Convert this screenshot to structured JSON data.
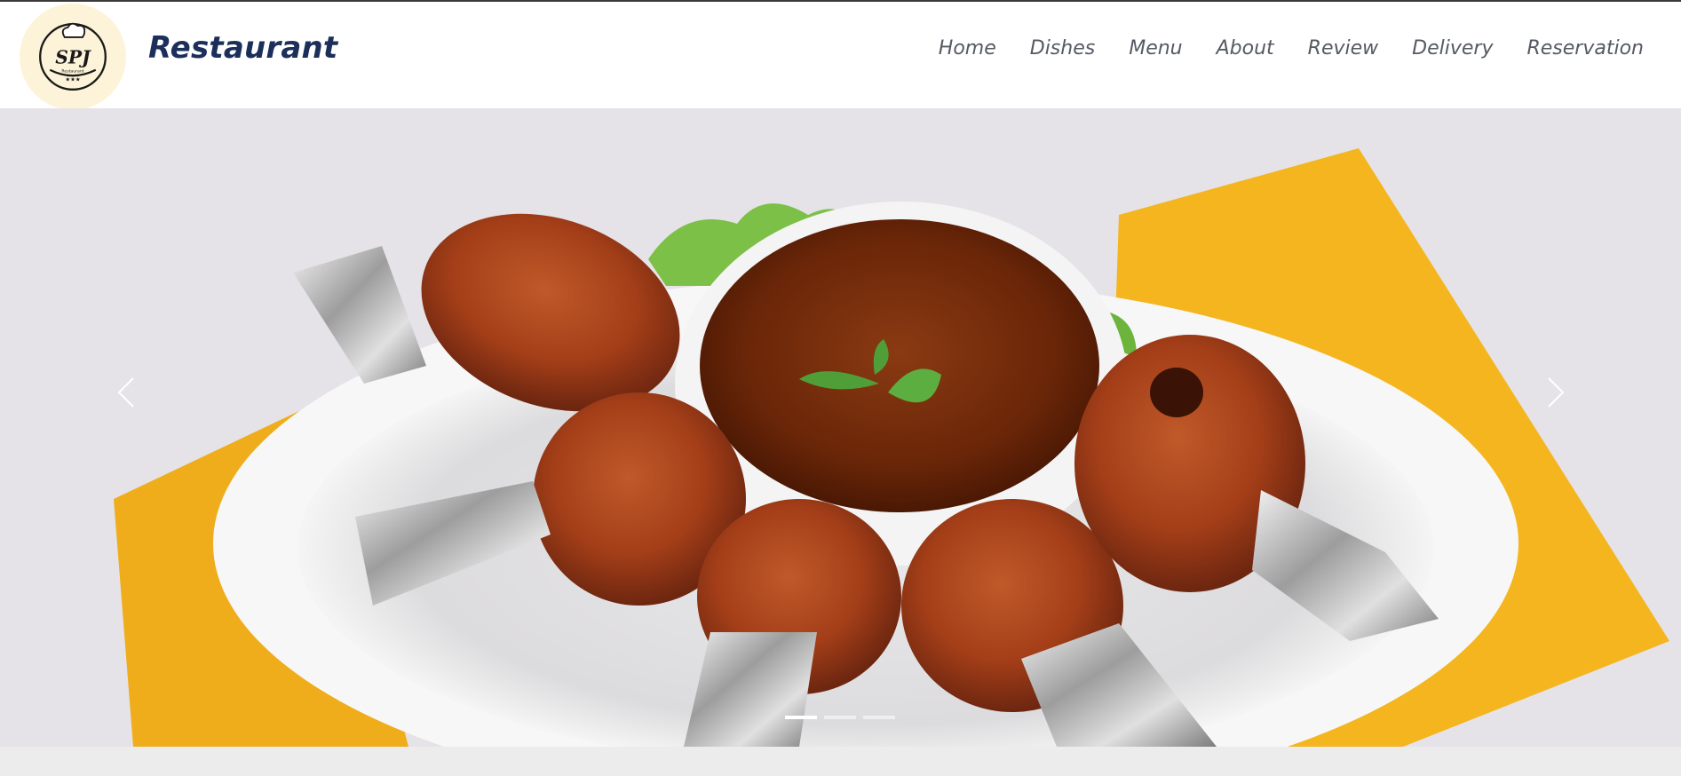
{
  "brand": {
    "name": "Restaurant",
    "logo_text": "SPJ",
    "logo_subtext": "Restaurant",
    "logo_icon": "chef-hat-icon"
  },
  "nav": {
    "items": [
      {
        "label": "Home"
      },
      {
        "label": "Dishes"
      },
      {
        "label": "Menu"
      },
      {
        "label": "About"
      },
      {
        "label": "Review"
      },
      {
        "label": "Delivery"
      },
      {
        "label": "Reservation"
      }
    ]
  },
  "carousel": {
    "prev_icon": "chevron-left-icon",
    "next_icon": "chevron-right-icon",
    "slide_count": 3,
    "active_index": 0
  },
  "colors": {
    "brand_text": "#1c2f5a",
    "nav_text": "#555a63",
    "logo_bg": "#fdf3d8"
  }
}
